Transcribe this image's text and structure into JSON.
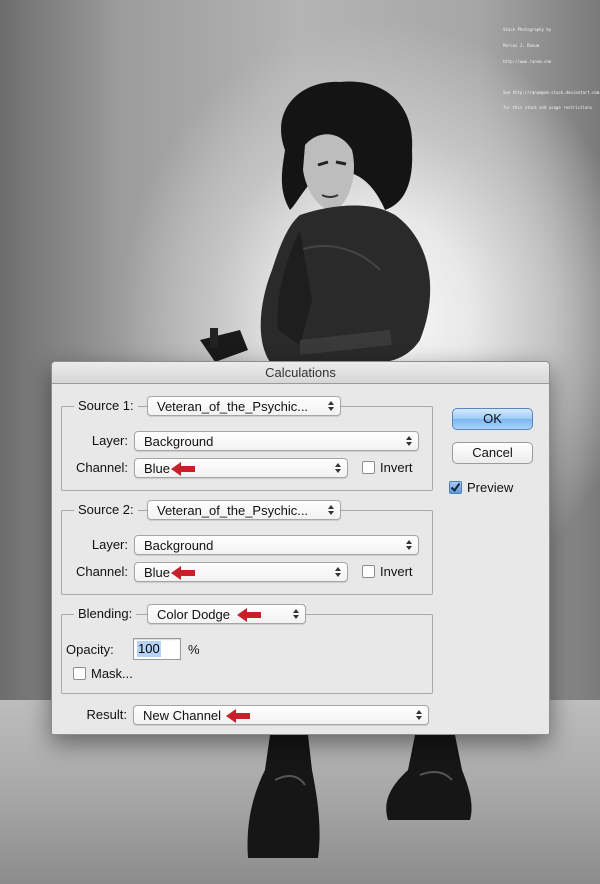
{
  "photo_credit": {
    "lines": [
      "Stock Photography by",
      "Marcus J. Ranum",
      "http://www.ranum.com",
      "",
      "See http://ranumpub-stock.deviantart.com",
      "for this stock and usage restrictions"
    ]
  },
  "dialog": {
    "title": "Calculations",
    "source1": {
      "label": "Source 1:",
      "file": "Veteran_of_the_Psychic...",
      "layer_label": "Layer:",
      "layer": "Background",
      "channel_label": "Channel:",
      "channel": "Blue",
      "invert_label": "Invert",
      "invert": false
    },
    "source2": {
      "label": "Source 2:",
      "file": "Veteran_of_the_Psychic...",
      "layer_label": "Layer:",
      "layer": "Background",
      "channel_label": "Channel:",
      "channel": "Blue",
      "invert_label": "Invert",
      "invert": false
    },
    "blending": {
      "label": "Blending:",
      "mode": "Color Dodge",
      "opacity_label": "Opacity:",
      "opacity": "100",
      "opacity_unit": "%",
      "mask_label": "Mask...",
      "mask": false
    },
    "result": {
      "label": "Result:",
      "value": "New Channel"
    },
    "buttons": {
      "ok": "OK",
      "cancel": "Cancel"
    },
    "preview": {
      "label": "Preview",
      "checked": true
    }
  },
  "colors": {
    "annotation_arrow": "#c8202a",
    "default_button": "#8fc3f4"
  }
}
